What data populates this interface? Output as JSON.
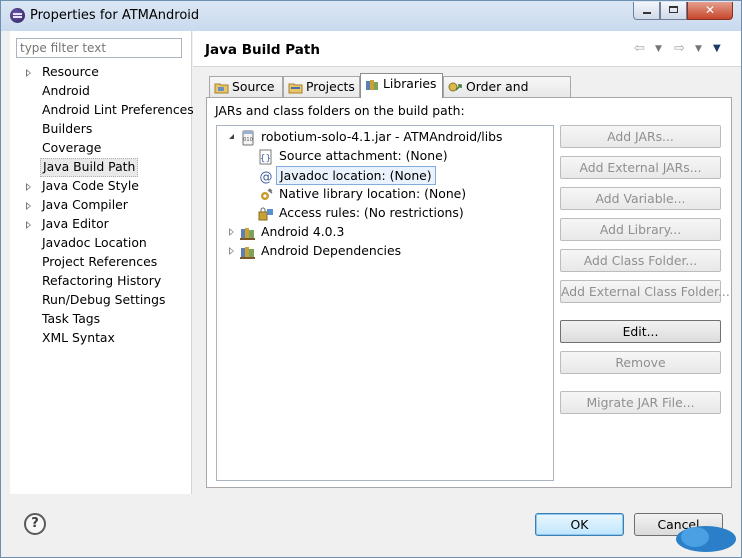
{
  "window": {
    "title": "Properties for ATMAndroid"
  },
  "sidebar": {
    "filter_placeholder": "type filter text",
    "items": [
      {
        "label": "Resource",
        "expandable": true
      },
      {
        "label": "Android",
        "expandable": false
      },
      {
        "label": "Android Lint Preferences",
        "expandable": false
      },
      {
        "label": "Builders",
        "expandable": false
      },
      {
        "label": "Coverage",
        "expandable": false
      },
      {
        "label": "Java Build Path",
        "expandable": false,
        "selected": true
      },
      {
        "label": "Java Code Style",
        "expandable": true
      },
      {
        "label": "Java Compiler",
        "expandable": true
      },
      {
        "label": "Java Editor",
        "expandable": true
      },
      {
        "label": "Javadoc Location",
        "expandable": false
      },
      {
        "label": "Project References",
        "expandable": false
      },
      {
        "label": "Refactoring History",
        "expandable": false
      },
      {
        "label": "Run/Debug Settings",
        "expandable": false
      },
      {
        "label": "Task Tags",
        "expandable": false
      },
      {
        "label": "XML Syntax",
        "expandable": false
      }
    ]
  },
  "page": {
    "title": "Java Build Path",
    "nav": {
      "back": "⇦",
      "forward": "⇨",
      "dropdown": "▼",
      "menu": "▼"
    }
  },
  "tabs": [
    {
      "label": "Source",
      "icon": "source-folder-icon"
    },
    {
      "label": "Projects",
      "icon": "projects-icon"
    },
    {
      "label": "Libraries",
      "icon": "libraries-icon",
      "active": true
    },
    {
      "label": "Order and Export",
      "icon": "order-export-icon"
    }
  ],
  "libraries": {
    "section_label": "JARs and class folders on the build path:",
    "tree": [
      {
        "label": "robotium-solo-4.1.jar - ATMAndroid/libs",
        "icon": "jar-icon",
        "level": 0,
        "expanded": true
      },
      {
        "label": "Source attachment: (None)",
        "icon": "source-attachment-icon",
        "level": 1
      },
      {
        "label": "Javadoc location: (None)",
        "icon": "javadoc-icon",
        "level": 1,
        "selected": true
      },
      {
        "label": "Native library location: (None)",
        "icon": "native-library-icon",
        "level": 1
      },
      {
        "label": "Access rules: (No restrictions)",
        "icon": "access-rules-icon",
        "level": 1
      },
      {
        "label": "Android 4.0.3",
        "icon": "library-container-icon",
        "level": 0,
        "expanded": false
      },
      {
        "label": "Android Dependencies",
        "icon": "library-container-icon",
        "level": 0,
        "expanded": false
      }
    ],
    "buttons": [
      {
        "label": "Add JARs...",
        "enabled": false
      },
      {
        "label": "Add External JARs...",
        "enabled": false
      },
      {
        "label": "Add Variable...",
        "enabled": false
      },
      {
        "label": "Add Library...",
        "enabled": false
      },
      {
        "label": "Add Class Folder...",
        "enabled": false
      },
      {
        "label": "Add External Class Folder...",
        "enabled": false
      },
      {
        "label": "Edit...",
        "enabled": true
      },
      {
        "label": "Remove",
        "enabled": false
      },
      {
        "label": "Migrate JAR File...",
        "enabled": false
      }
    ]
  },
  "footer": {
    "help": "?",
    "ok_label": "OK",
    "cancel_label": "Cancel"
  },
  "colors": {
    "accent": "#3c7fb1",
    "selection_border": "#84acdd",
    "disabled_text": "#8f8f8f"
  }
}
